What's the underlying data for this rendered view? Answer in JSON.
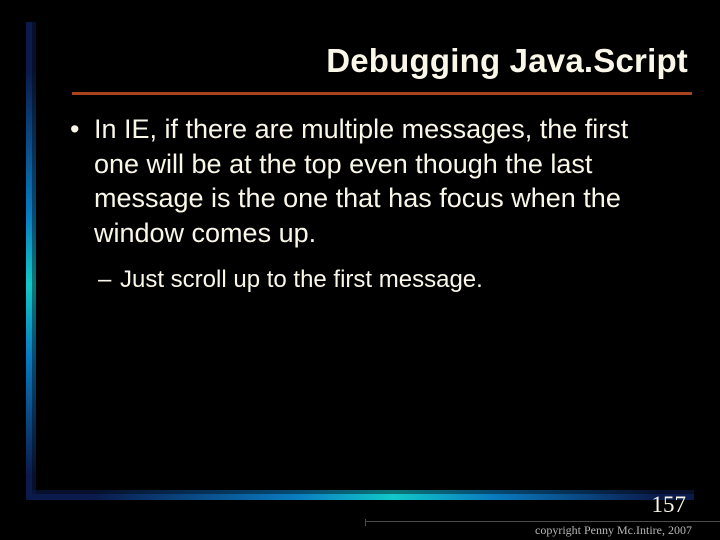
{
  "title": "Debugging Java.Script",
  "bullets": {
    "level1": "In IE, if there are multiple messages, the first one will be at the top even though the last message is the one that has focus when the window comes up.",
    "level2": "Just scroll up to the first message."
  },
  "page_number": "157",
  "copyright": "copyright Penny Mc.Intire, 2007"
}
